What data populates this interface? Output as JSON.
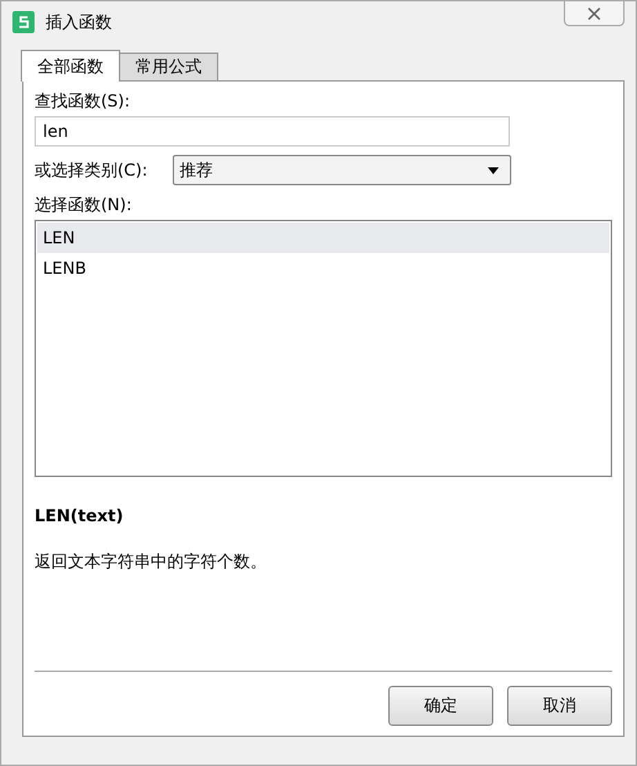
{
  "window": {
    "title": "插入函数"
  },
  "tabs": [
    {
      "label": "全部函数",
      "selected": true
    },
    {
      "label": "常用公式",
      "selected": false
    }
  ],
  "search": {
    "label": "查找函数(S):",
    "value": "len"
  },
  "category": {
    "label": "或选择类别(C):",
    "value": "推荐"
  },
  "functions": {
    "label": "选择函数(N):",
    "items": [
      {
        "name": "LEN",
        "selected": true
      },
      {
        "name": "LENB",
        "selected": false
      }
    ]
  },
  "signature": "LEN(text)",
  "description": "返回文本字符串中的字符个数。",
  "buttons": [
    "确定",
    "取消"
  ]
}
